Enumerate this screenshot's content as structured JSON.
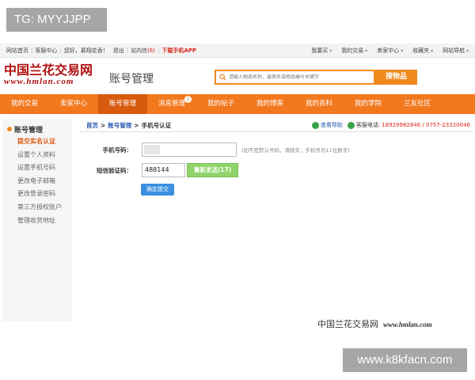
{
  "watermark": {
    "top_left": "TG: MYYJJPP",
    "bottom_right": "www.k8kfacn.com"
  },
  "topbar": {
    "left": [
      "网站首页",
      "客服中心",
      "您好，",
      "慕翔花香",
      "！",
      "退出",
      "站内信"
    ],
    "message_count": "(6)",
    "app_link": "下载手机APP",
    "right": [
      "我要买",
      "我的交易",
      "卖家中心",
      "收藏夹",
      "网站导航"
    ]
  },
  "header": {
    "logo_cn": "中国兰花交易网",
    "logo_en": "www.hmlan.com",
    "title": "账号管理",
    "search_placeholder": "请输入物品名称，要原名或物品编号关键字",
    "search_button": "搜物品"
  },
  "nav": {
    "items": [
      "我的交易",
      "卖家中心",
      "账号管理",
      "消息管理",
      "我的帖子",
      "我的博客",
      "我的百科",
      "我的学院",
      "兰友社区"
    ],
    "active_index": 2,
    "badge": "2"
  },
  "sidebar": {
    "title": "账号管理",
    "items": [
      "提交实名认证",
      "设置个人资料",
      "设置手机号码",
      "更改电子邮箱",
      "更改登录密码",
      "第三方授权账户",
      "管理收货地址"
    ],
    "active_index": 0
  },
  "main": {
    "breadcrumb": {
      "home": "首页",
      "section": "账号管理",
      "current": "手机号认证",
      "sep": ">"
    },
    "help": "查看帮助",
    "phone_label": "客服电话:",
    "phone_numbers": "18929982846 / 0757-23320046",
    "form": {
      "phone_label": "手机号码：",
      "phone_hint": "(如不是默认号码，请核实，手机号为11位数字)",
      "code_label": "短信验证码：",
      "code_value": "488144",
      "resend": "重新发送(17)",
      "submit": "确定提交"
    }
  },
  "footer": {
    "brand_cn": "中国兰花交易网",
    "brand_url": "www.hmlan.com"
  },
  "colors": {
    "accent": "#f2781e",
    "link": "#2a5db0",
    "brand_red": "#b01010",
    "resend_green": "#8fd46a",
    "submit_blue": "#3a8fe0"
  }
}
